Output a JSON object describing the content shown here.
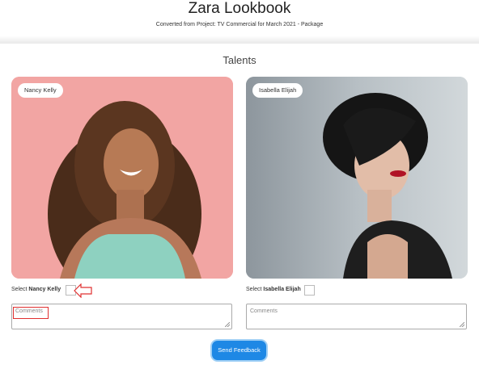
{
  "header": {
    "title": "Zara Lookbook",
    "subtitle": "Converted from Project: TV Commercial for March 2021 - Package"
  },
  "section": {
    "title": "Talents"
  },
  "talents": [
    {
      "name": "Nancy Kelly",
      "select_prefix": "Select",
      "select_name": "Nancy Kelly",
      "checked": false,
      "comments_placeholder": "Comments",
      "comments_value": ""
    },
    {
      "name": "Isabella Elijah",
      "select_prefix": "Select",
      "select_name": "Isabella Elijah",
      "checked": false,
      "comments_placeholder": "Comments",
      "comments_value": ""
    }
  ],
  "actions": {
    "send_label": "Send Feedback"
  },
  "colors": {
    "accent": "#1e88e5",
    "highlight": "#e03030"
  }
}
